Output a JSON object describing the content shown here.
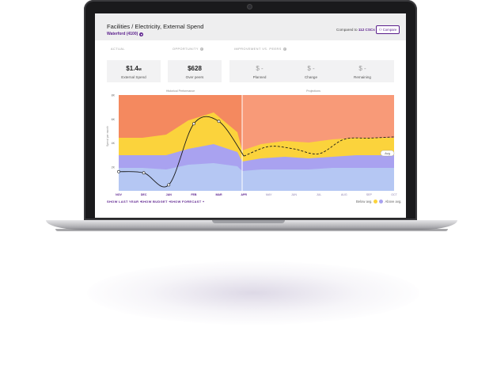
{
  "header": {
    "title": "Facilities / Electricity, External Spend",
    "subtitle": "Waterford (4100)",
    "compared_prefix": "Compared to",
    "compared_count": "112 CSCs",
    "compare_button": "Compare"
  },
  "metrics": {
    "actual_label": "ACTUAL",
    "actual_value": "$1.4",
    "actual_value_suffix": "M",
    "actual_caption": "External Spend",
    "opportunity_label": "OPPORTUNITY",
    "opportunity_value": "$628",
    "opportunity_caption": "Over peers",
    "improvement_label": "IMPROVEMENT VS. PEERS",
    "planned_value": "$ -",
    "planned_caption": "Planned",
    "change_value": "$ -",
    "change_caption": "Change",
    "remaining_value": "$ -",
    "remaining_caption": "Remaining"
  },
  "chart": {
    "historical_label": "Historical Performance",
    "projections_label": "Projections",
    "y_axis_label": "Spend per month",
    "y_ticks": [
      "8K",
      "6K",
      "4K",
      "2K"
    ],
    "x_ticks": [
      "NOV",
      "DEC",
      "JAN",
      "FEB",
      "MAR",
      "APR",
      "MAY",
      "JUN",
      "JUL",
      "AUG",
      "SEP",
      "OCT"
    ],
    "avg_tag": "Avg",
    "colors": {
      "top": "#f4895f",
      "projection_top": "#f89a78",
      "yellow": "#fbd33c",
      "lavender": "#a9a2f0",
      "blue": "#b5c7f3"
    }
  },
  "chart_data": {
    "type": "area",
    "categories": [
      "NOV",
      "DEC",
      "JAN",
      "FEB",
      "MAR",
      "APR",
      "MAY",
      "JUN",
      "JUL",
      "AUG",
      "SEP",
      "OCT"
    ],
    "ylim": [
      0,
      8000
    ],
    "series": [
      {
        "name": "Actual",
        "values": [
          1600,
          1500,
          500,
          5600,
          5800,
          2900
        ]
      },
      {
        "name": "Projection",
        "values": [
          2900,
          3700,
          3500,
          3100,
          4300,
          4400,
          4500
        ]
      }
    ]
  },
  "footer": {
    "show_last_year": "SHOW LAST YEAR",
    "show_budget": "SHOW BUDGET",
    "show_forecast": "SHOW FORECAST",
    "below_avg": "Below avg.",
    "above_avg": "Above avg."
  }
}
